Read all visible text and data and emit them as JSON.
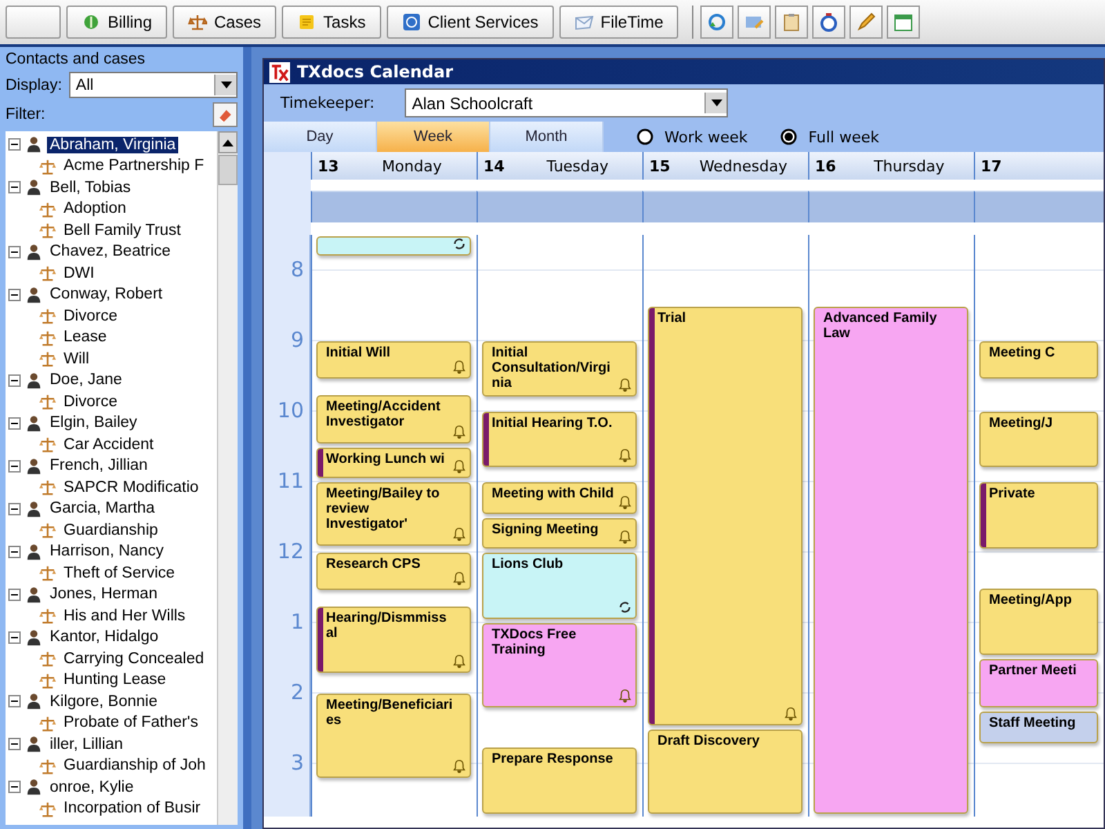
{
  "toolbar": {
    "buttons": [
      "Billing",
      "Cases",
      "Tasks",
      "Client Services",
      "FileTime"
    ]
  },
  "sidebar": {
    "title": "Contacts and cases",
    "display_label": "Display:",
    "display_value": "All",
    "filter_label": "Filter:",
    "tree": [
      {
        "name": "Abraham, Virginia",
        "selected": true,
        "expanded": true,
        "children": [
          {
            "name": "Acme Partnership F",
            "selected": false
          }
        ]
      },
      {
        "name": "Bell, Tobias",
        "selected": false,
        "expanded": true,
        "children": [
          {
            "name": "Adoption",
            "selected": false
          },
          {
            "name": "Bell Family Trust",
            "selected": false
          }
        ]
      },
      {
        "name": "Chavez, Beatrice",
        "selected": false,
        "expanded": true,
        "children": [
          {
            "name": "DWI",
            "selected": false
          }
        ]
      },
      {
        "name": "Conway, Robert",
        "selected": false,
        "expanded": true,
        "children": [
          {
            "name": "Divorce",
            "selected": false
          },
          {
            "name": "Lease",
            "selected": false
          },
          {
            "name": "Will",
            "selected": false
          }
        ]
      },
      {
        "name": "Doe, Jane",
        "selected": false,
        "expanded": true,
        "children": [
          {
            "name": "Divorce",
            "selected": false
          }
        ]
      },
      {
        "name": "Elgin, Bailey",
        "selected": false,
        "expanded": true,
        "children": [
          {
            "name": "Car Accident",
            "selected": false
          }
        ]
      },
      {
        "name": "French, Jillian",
        "selected": false,
        "expanded": true,
        "children": [
          {
            "name": "SAPCR Modificatio",
            "selected": false
          }
        ]
      },
      {
        "name": "Garcia, Martha",
        "selected": false,
        "expanded": true,
        "children": [
          {
            "name": "Guardianship",
            "selected": false
          }
        ]
      },
      {
        "name": "Harrison, Nancy",
        "selected": false,
        "expanded": true,
        "children": [
          {
            "name": "Theft of Service",
            "selected": false
          }
        ]
      },
      {
        "name": "Jones, Herman",
        "selected": false,
        "expanded": true,
        "children": [
          {
            "name": "His and Her Wills",
            "selected": false
          }
        ]
      },
      {
        "name": "Kantor, Hidalgo",
        "selected": false,
        "expanded": true,
        "children": [
          {
            "name": "Carrying Concealed",
            "selected": false
          },
          {
            "name": "Hunting Lease",
            "selected": false
          }
        ]
      },
      {
        "name": "Kilgore, Bonnie",
        "selected": false,
        "expanded": true,
        "children": [
          {
            "name": "Probate of Father's",
            "selected": false
          }
        ]
      },
      {
        "name": "iller, Lillian",
        "selected": false,
        "expanded": true,
        "children": [
          {
            "name": "Guardianship of Joh",
            "selected": false
          }
        ]
      },
      {
        "name": "onroe, Kylie",
        "selected": false,
        "expanded": true,
        "children": [
          {
            "name": "Incorpation of Busir",
            "selected": false
          }
        ]
      }
    ]
  },
  "calendar": {
    "title": "TXdocs Calendar",
    "timekeeper_label": "Timekeeper:",
    "timekeeper": "Alan Schoolcraft",
    "tabs": [
      {
        "label": "Day",
        "selected": false
      },
      {
        "label": "Week",
        "selected": true
      },
      {
        "label": "Month",
        "selected": false
      }
    ],
    "week_options": [
      {
        "label": "Work week",
        "selected": false
      },
      {
        "label": "Full week",
        "selected": true
      }
    ],
    "hours": [
      "8",
      "9",
      "10",
      "11",
      "12",
      "1",
      "2",
      "3"
    ],
    "days": [
      {
        "number": "13",
        "name": "Monday",
        "events": [
          {
            "color": "#c8f4f6",
            "marked": false,
            "reminder": false,
            "recurring": true
          },
          {
            "title": "Initial Will",
            "color": "#f8df7a",
            "marked": false,
            "reminder": true,
            "recurring": false
          },
          {
            "title": "Meeting/Accident Investigator",
            "color": "#f8df7a",
            "marked": false,
            "reminder": true,
            "recurring": false
          },
          {
            "title": "Working Lunch wi",
            "color": "#f8df7a",
            "marked": true,
            "reminder": true,
            "recurring": false
          },
          {
            "title": "Meeting/Bailey to review Investigator'",
            "color": "#f8df7a",
            "marked": false,
            "reminder": true,
            "recurring": false
          },
          {
            "title": "Research CPS",
            "color": "#f8df7a",
            "marked": false,
            "reminder": true,
            "recurring": false
          },
          {
            "title": "Hearing/Dismmissal",
            "color": "#f8df7a",
            "marked": true,
            "reminder": true,
            "recurring": false
          },
          {
            "title": "Meeting/Beneficiaries",
            "color": "#f8df7a",
            "marked": false,
            "reminder": true,
            "recurring": false
          }
        ]
      },
      {
        "number": "14",
        "name": "Tuesday",
        "events": [
          {
            "title": "Initial Consultation/Virginia",
            "color": "#f8df7a",
            "marked": false,
            "reminder": true,
            "recurring": false
          },
          {
            "title": "Initial Hearing T.O.",
            "color": "#f8df7a",
            "marked": true,
            "reminder": true,
            "recurring": false
          },
          {
            "title": "Meeting with Child",
            "color": "#f8df7a",
            "marked": false,
            "reminder": true,
            "recurring": false
          },
          {
            "title": "Signing Meeting",
            "color": "#f8df7a",
            "marked": false,
            "reminder": true,
            "recurring": false
          },
          {
            "title": "Lions Club",
            "color": "#c8f4f6",
            "marked": false,
            "reminder": false,
            "recurring": true
          },
          {
            "title": "TXDocs Free Training",
            "color": "#f7a6f2",
            "marked": false,
            "reminder": true,
            "recurring": false
          },
          {
            "title": "Prepare Response",
            "color": "#f8df7a",
            "marked": false,
            "reminder": false,
            "recurring": false
          }
        ]
      },
      {
        "number": "15",
        "name": "Wednesday",
        "events": [
          {
            "title": "Trial",
            "color": "#f8df7a",
            "marked": true,
            "reminder": true,
            "recurring": false
          },
          {
            "title": "Draft Discovery",
            "color": "#f8df7a",
            "marked": false,
            "reminder": false,
            "recurring": false
          }
        ]
      },
      {
        "number": "16",
        "name": "Thursday",
        "events": [
          {
            "title": "Advanced Family Law",
            "color": "#f7a6f2",
            "marked": false,
            "reminder": false,
            "recurring": false
          }
        ]
      },
      {
        "number": "17",
        "events": [
          {
            "title": "Meeting C",
            "color": "#f8df7a",
            "marked": false,
            "reminder": false,
            "recurring": false
          },
          {
            "title": "Meeting/J",
            "color": "#f8df7a",
            "marked": false,
            "reminder": false,
            "recurring": false
          },
          {
            "title": "Private",
            "color": "#f8df7a",
            "marked": true,
            "reminder": false,
            "recurring": false
          },
          {
            "title": "Meeting/App",
            "color": "#f8df7a",
            "marked": false,
            "reminder": false,
            "recurring": false
          },
          {
            "title": "Partner Meeti",
            "color": "#f7a6f2",
            "marked": false,
            "reminder": false,
            "recurring": false
          },
          {
            "title": "Staff Meeting",
            "color": "#c4d0ec",
            "marked": false,
            "reminder": false,
            "recurring": false
          }
        ]
      }
    ]
  }
}
